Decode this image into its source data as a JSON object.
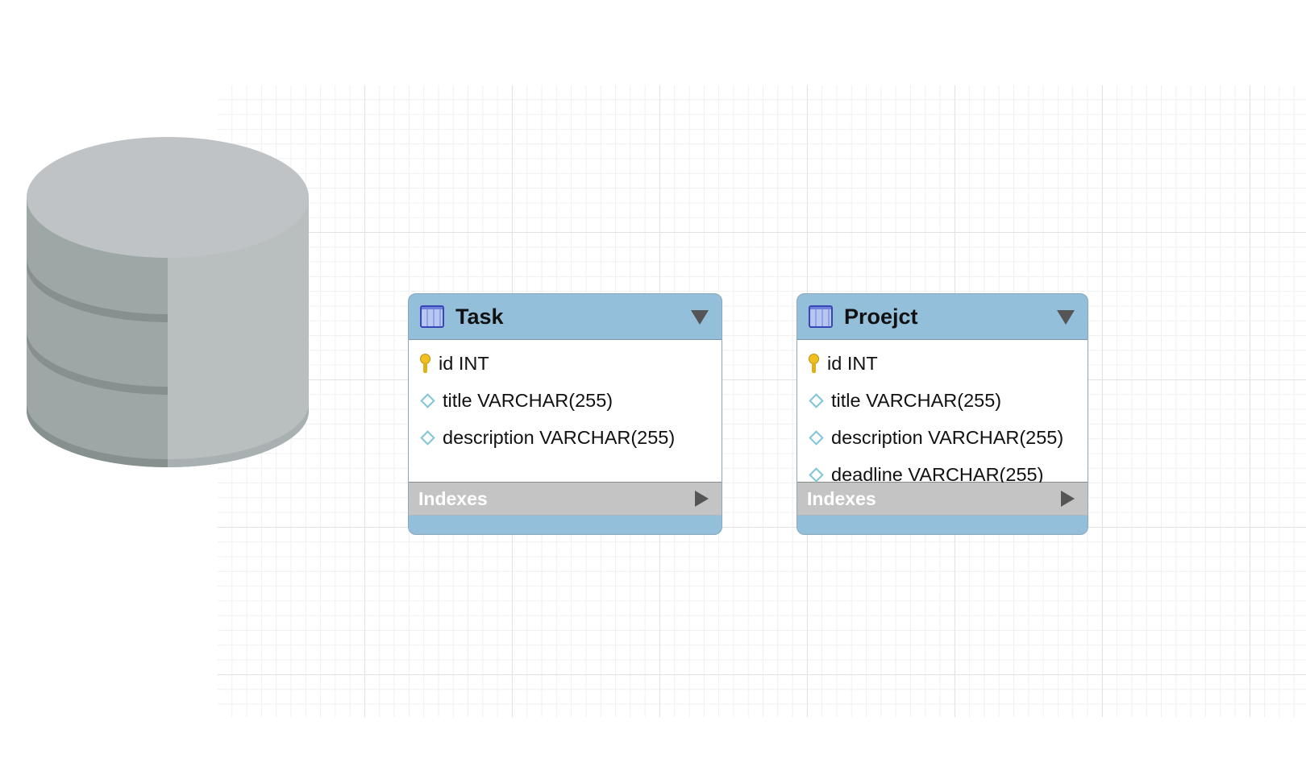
{
  "tables": [
    {
      "name": "Task",
      "columns": [
        {
          "label": "id INT",
          "icon": "primary-key-icon"
        },
        {
          "label": "title VARCHAR(255)",
          "icon": "column-diamond-icon"
        },
        {
          "label": "description VARCHAR(255)",
          "icon": "column-diamond-icon"
        }
      ],
      "indexes_label": "Indexes"
    },
    {
      "name": "Proejct",
      "columns": [
        {
          "label": "id INT",
          "icon": "primary-key-icon"
        },
        {
          "label": "title VARCHAR(255)",
          "icon": "column-diamond-icon"
        },
        {
          "label": "description VARCHAR(255)",
          "icon": "column-diamond-icon"
        },
        {
          "label": "deadline VARCHAR(255)",
          "icon": "column-diamond-icon"
        }
      ],
      "indexes_label": "Indexes"
    }
  ],
  "colors": {
    "header": "#93bfda",
    "indexes_bar": "#c4c4c4",
    "database_icon": "#9aa5a5"
  },
  "icons": {
    "database": "database-cylinder-icon",
    "table": "table-icon",
    "collapse": "triangle-down-icon",
    "expand": "triangle-right-icon"
  }
}
